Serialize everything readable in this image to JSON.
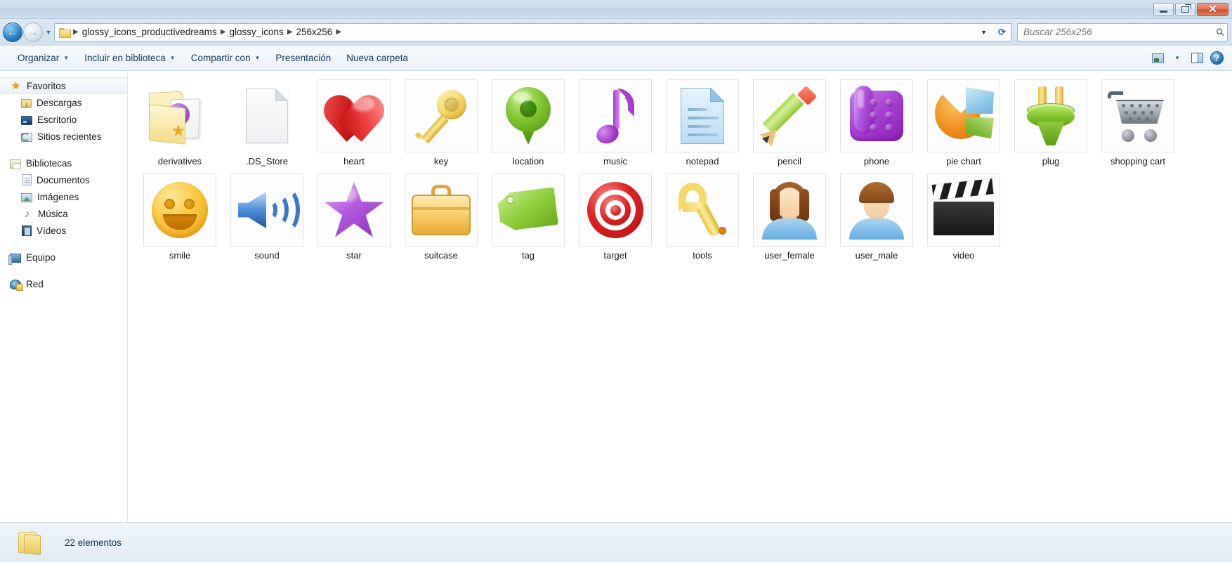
{
  "window": {
    "controls": {
      "minimize": "Minimizar",
      "maximize": "Restaurar",
      "close": "Cerrar"
    }
  },
  "address": {
    "back_label": "Atrás",
    "forward_label": "Adelante",
    "history_label": "Páginas recientes",
    "breadcrumbs": [
      "glossy_icons_productivedreams",
      "glossy_icons",
      "256x256"
    ],
    "refresh_label": "Actualizar"
  },
  "search": {
    "placeholder": "Buscar 256x256",
    "value": ""
  },
  "toolbar": {
    "items": [
      {
        "label": "Organizar",
        "has_caret": true
      },
      {
        "label": "Incluir en biblioteca",
        "has_caret": true
      },
      {
        "label": "Compartir con",
        "has_caret": true
      },
      {
        "label": "Presentación",
        "has_caret": false
      },
      {
        "label": "Nueva carpeta",
        "has_caret": false
      }
    ],
    "view_label": "Cambiar la vista",
    "preview_label": "Mostrar el panel de vista previa",
    "help_label": "Obtener ayuda"
  },
  "sidebar": {
    "groups": [
      {
        "header": {
          "label": "Favoritos",
          "icon": "star-icon",
          "selected": true
        },
        "items": [
          {
            "label": "Descargas",
            "icon": "downloads-folder-icon"
          },
          {
            "label": "Escritorio",
            "icon": "desktop-icon"
          },
          {
            "label": "Sitios recientes",
            "icon": "recent-places-icon"
          }
        ]
      },
      {
        "header": {
          "label": "Bibliotecas",
          "icon": "libraries-icon",
          "selected": false
        },
        "items": [
          {
            "label": "Documentos",
            "icon": "documents-icon"
          },
          {
            "label": "Imágenes",
            "icon": "pictures-icon"
          },
          {
            "label": "Música",
            "icon": "music-icon"
          },
          {
            "label": "Vídeos",
            "icon": "videos-icon"
          }
        ]
      },
      {
        "header": {
          "label": "Equipo",
          "icon": "computer-icon",
          "selected": false
        },
        "items": []
      },
      {
        "header": {
          "label": "Red",
          "icon": "network-icon",
          "selected": false
        },
        "items": []
      }
    ]
  },
  "files": [
    {
      "name": "derivatives",
      "icon": "open-folder-media-icon",
      "framed": false
    },
    {
      "name": ".DS_Store",
      "icon": "blank-document-icon",
      "framed": false
    },
    {
      "name": "heart",
      "icon": "heart-icon",
      "framed": true
    },
    {
      "name": "key",
      "icon": "key-icon",
      "framed": true
    },
    {
      "name": "location",
      "icon": "location-pin-icon",
      "framed": true
    },
    {
      "name": "music",
      "icon": "music-note-icon",
      "framed": true
    },
    {
      "name": "notepad",
      "icon": "notepad-icon",
      "framed": true
    },
    {
      "name": "pencil",
      "icon": "pencil-icon",
      "framed": true
    },
    {
      "name": "phone",
      "icon": "phone-icon",
      "framed": true
    },
    {
      "name": "pie chart",
      "icon": "pie-chart-icon",
      "framed": true
    },
    {
      "name": "plug",
      "icon": "plug-icon",
      "framed": true
    },
    {
      "name": "shopping cart",
      "icon": "shopping-cart-icon",
      "framed": true
    },
    {
      "name": "smile",
      "icon": "smile-icon",
      "framed": true
    },
    {
      "name": "sound",
      "icon": "sound-icon",
      "framed": true
    },
    {
      "name": "star",
      "icon": "star-icon",
      "framed": true
    },
    {
      "name": "suitcase",
      "icon": "suitcase-icon",
      "framed": true
    },
    {
      "name": "tag",
      "icon": "tag-icon",
      "framed": true
    },
    {
      "name": "target",
      "icon": "target-icon",
      "framed": true
    },
    {
      "name": "tools",
      "icon": "wrench-icon",
      "framed": true
    },
    {
      "name": "user_female",
      "icon": "user-female-icon",
      "framed": true
    },
    {
      "name": "user_male",
      "icon": "user-male-icon",
      "framed": true
    },
    {
      "name": "video",
      "icon": "clapperboard-icon",
      "framed": true
    }
  ],
  "status": {
    "text": "22 elementos",
    "icon": "folder-icon"
  },
  "colors": {
    "chrome": "#d3e2f0",
    "accent": "#2b6aa5",
    "close_button": "#cf4f2c",
    "text": "#1a1a1a"
  }
}
